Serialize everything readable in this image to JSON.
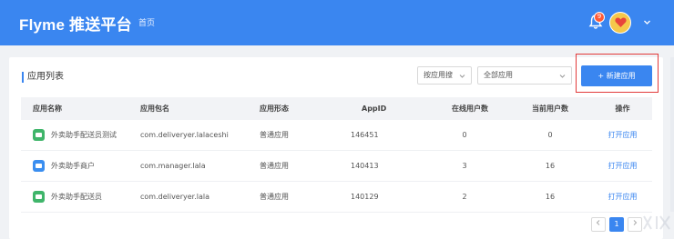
{
  "header": {
    "brand": "Flyme 推送平台",
    "nav_home": "首页",
    "notification_count": "9",
    "colors": {
      "bar": "#3a86f0",
      "badge": "#ff5a36",
      "avatar": "#f5c84b"
    }
  },
  "card": {
    "title": "应用列表",
    "filter_by": {
      "selected": "按应用搜"
    },
    "app_filter": {
      "selected": "全部应用"
    },
    "new_button": "+ 新建应用"
  },
  "table": {
    "columns": [
      "应用名称",
      "应用包名",
      "应用形态",
      "AppID",
      "在线用户数",
      "当前用户数",
      "操作"
    ],
    "rows": [
      {
        "name": "外卖助手配送员测试",
        "package": "com.deliveryer.lalaceshi",
        "form": "普通应用",
        "appid": "146451",
        "online": "0",
        "current": "0",
        "action": "打开应用",
        "icon_color": "#3fb56a",
        "icon": "delivery-app-icon"
      },
      {
        "name": "外卖助手商户",
        "package": "com.manager.lala",
        "form": "普通应用",
        "appid": "140413",
        "online": "3",
        "current": "16",
        "action": "打开应用",
        "icon_color": "#3a8ef0",
        "icon": "merchant-app-icon"
      },
      {
        "name": "外卖助手配送员",
        "package": "com.deliveryer.lala",
        "form": "普通应用",
        "appid": "140129",
        "online": "2",
        "current": "16",
        "action": "打开应用",
        "icon_color": "#3fb56a",
        "icon": "delivery-app-icon"
      }
    ]
  },
  "pagination": {
    "current": "1"
  }
}
